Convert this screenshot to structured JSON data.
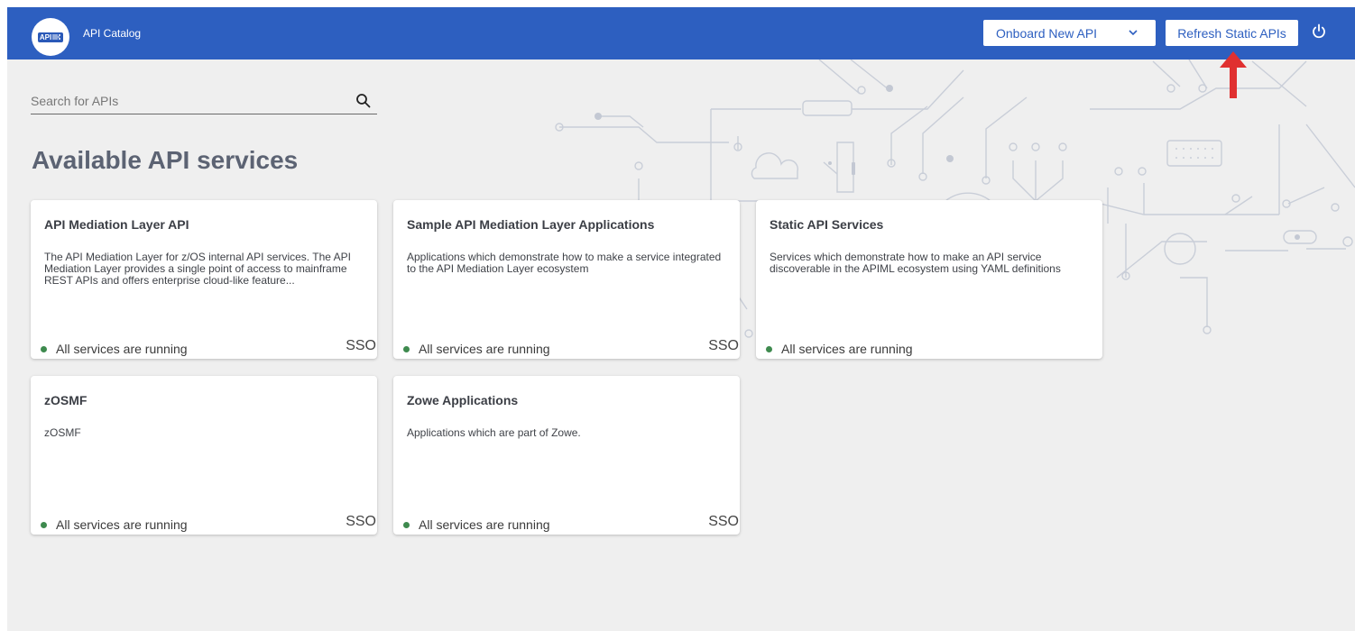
{
  "header": {
    "logo_text": "API",
    "title": "API Catalog",
    "onboard_label": "Onboard New API",
    "refresh_label": "Refresh Static APIs",
    "power_icon": "power-icon"
  },
  "search": {
    "placeholder": "Search for APIs"
  },
  "page_heading": "Available API services",
  "cards": [
    {
      "title": "API Mediation Layer API",
      "description": "The API Mediation Layer for z/OS internal API services. The API Mediation Layer provides a single point of access to mainframe REST APIs and offers enterprise cloud-like feature...",
      "status": "All services are running",
      "sso": "SSO"
    },
    {
      "title": "Sample API Mediation Layer Applications",
      "description": "Applications which demonstrate how to make a service integrated to the API Mediation Layer ecosystem",
      "status": "All services are running",
      "sso": "SSO"
    },
    {
      "title": "Static API Services",
      "description": "Services which demonstrate how to make an API service discoverable in the APIML ecosystem using YAML definitions",
      "status": "All services are running",
      "sso": ""
    },
    {
      "title": "zOSMF",
      "description": "zOSMF",
      "status": "All services are running",
      "sso": "SSO"
    },
    {
      "title": "Zowe Applications",
      "description": "Applications which are part of Zowe.",
      "status": "All services are running",
      "sso": "SSO"
    }
  ],
  "colors": {
    "header_bg": "#2d5fc0",
    "status_running": "#3e8a4e",
    "annotation_arrow": "#e03030"
  }
}
